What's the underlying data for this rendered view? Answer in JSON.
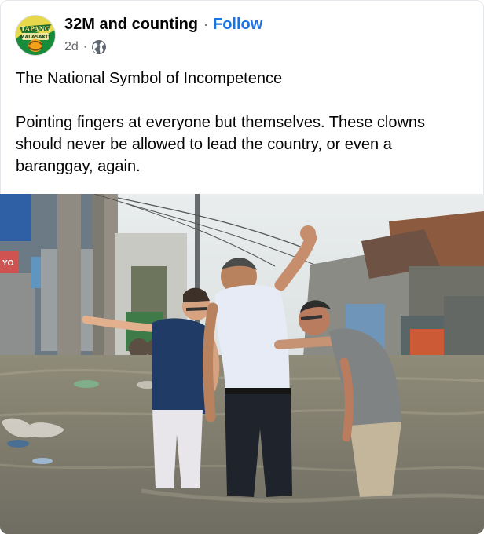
{
  "post": {
    "page_name": "32M and counting",
    "separator": "·",
    "follow_label": "Follow",
    "timestamp": "2d",
    "time_separator": "·",
    "privacy_icon": "globe-icon",
    "avatar_text": [
      "TAPANG",
      "MALASAKIT"
    ],
    "caption_title": "The National Symbol of Incompetence",
    "caption_body": "Pointing fingers at everyone but themselves. These clowns should never be allowed to lead the country, or even a baranggay, again."
  },
  "photo": {
    "description_icon": "flood-street-photo",
    "left_sign_text": "YO"
  },
  "colors": {
    "follow": "#1b74e4",
    "secondary_text": "#65676b",
    "primary_text": "#050505"
  }
}
